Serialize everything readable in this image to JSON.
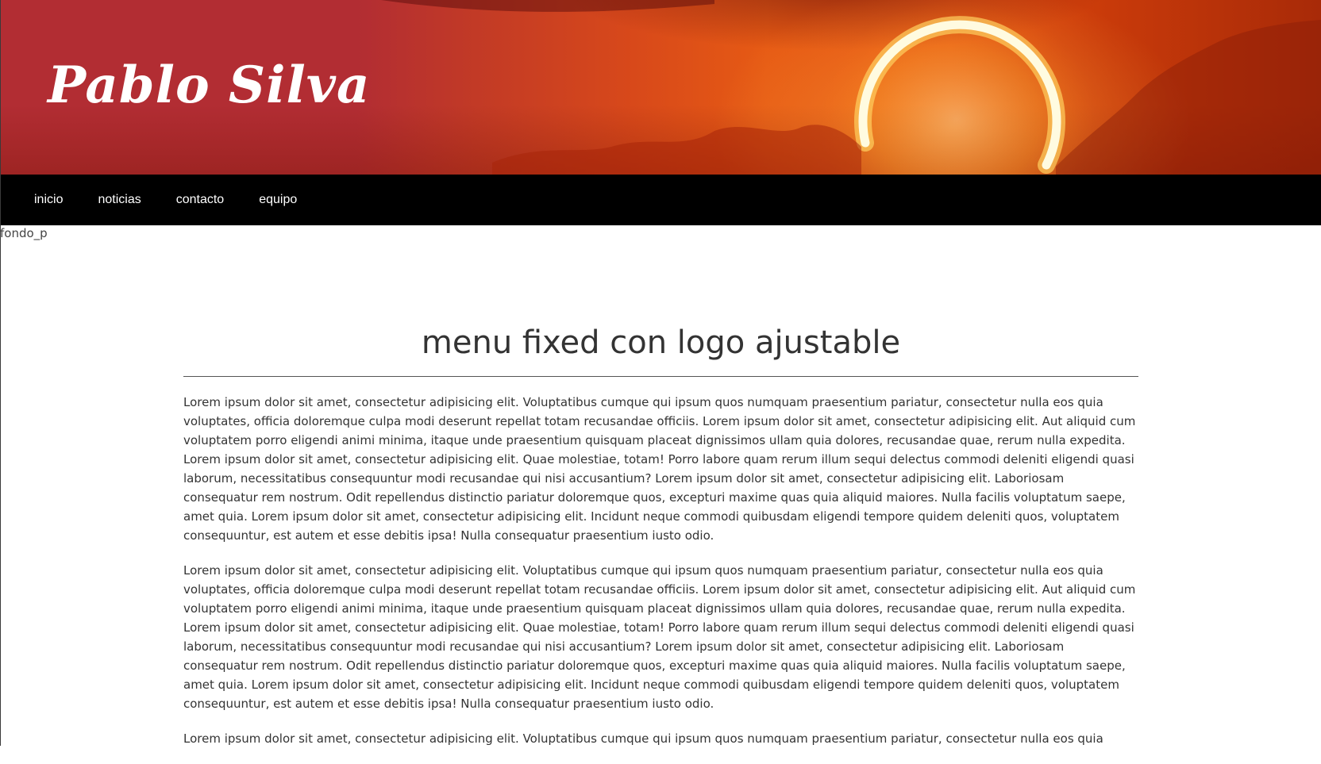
{
  "site": {
    "title": "Pablo Silva"
  },
  "nav": {
    "items": [
      {
        "label": "inicio"
      },
      {
        "label": "noticias"
      },
      {
        "label": "contacto"
      },
      {
        "label": "equipo"
      }
    ]
  },
  "banner_image": {
    "alt": "fondo_p"
  },
  "main": {
    "heading": "menu fixed con logo ajustable",
    "paragraphs": [
      "Lorem ipsum dolor sit amet, consectetur adipisicing elit. Voluptatibus cumque qui ipsum quos numquam praesentium pariatur, consectetur nulla eos quia voluptates, officia doloremque culpa modi deserunt repellat totam recusandae officiis. Lorem ipsum dolor sit amet, consectetur adipisicing elit. Aut aliquid cum voluptatem porro eligendi animi minima, itaque unde praesentium quisquam placeat dignissimos ullam quia dolores, recusandae quae, rerum nulla expedita. Lorem ipsum dolor sit amet, consectetur adipisicing elit. Quae molestiae, totam! Porro labore quam rerum illum sequi delectus commodi deleniti eligendi quasi laborum, necessitatibus consequuntur modi recusandae qui nisi accusantium? Lorem ipsum dolor sit amet, consectetur adipisicing elit. Laboriosam consequatur rem nostrum. Odit repellendus distinctio pariatur doloremque quos, excepturi maxime quas quia aliquid maiores. Nulla facilis voluptatum saepe, amet quia. Lorem ipsum dolor sit amet, consectetur adipisicing elit. Incidunt neque commodi quibusdam eligendi tempore quidem deleniti quos, voluptatem consequuntur, est autem et esse debitis ipsa! Nulla consequatur praesentium iusto odio.",
      "Lorem ipsum dolor sit amet, consectetur adipisicing elit. Voluptatibus cumque qui ipsum quos numquam praesentium pariatur, consectetur nulla eos quia voluptates, officia doloremque culpa modi deserunt repellat totam recusandae officiis. Lorem ipsum dolor sit amet, consectetur adipisicing elit. Aut aliquid cum voluptatem porro eligendi animi minima, itaque unde praesentium quisquam placeat dignissimos ullam quia dolores, recusandae quae, rerum nulla expedita. Lorem ipsum dolor sit amet, consectetur adipisicing elit. Quae molestiae, totam! Porro labore quam rerum illum sequi delectus commodi deleniti eligendi quasi laborum, necessitatibus consequuntur modi recusandae qui nisi accusantium? Lorem ipsum dolor sit amet, consectetur adipisicing elit. Laboriosam consequatur rem nostrum. Odit repellendus distinctio pariatur doloremque quos, excepturi maxime quas quia aliquid maiores. Nulla facilis voluptatum saepe, amet quia. Lorem ipsum dolor sit amet, consectetur adipisicing elit. Incidunt neque commodi quibusdam eligendi tempore quidem deleniti quos, voluptatem consequuntur, est autem et esse debitis ipsa! Nulla consequatur praesentium iusto odio.",
      "Lorem ipsum dolor sit amet, consectetur adipisicing elit. Voluptatibus cumque qui ipsum quos numquam praesentium pariatur, consectetur nulla eos quia"
    ]
  },
  "colors": {
    "header_red": "#b22d33",
    "sky_orange": "#e65a14",
    "nav_background": "#000000",
    "text": "#333333"
  },
  "icons": {
    "banner_art": "eclipse-ring"
  }
}
